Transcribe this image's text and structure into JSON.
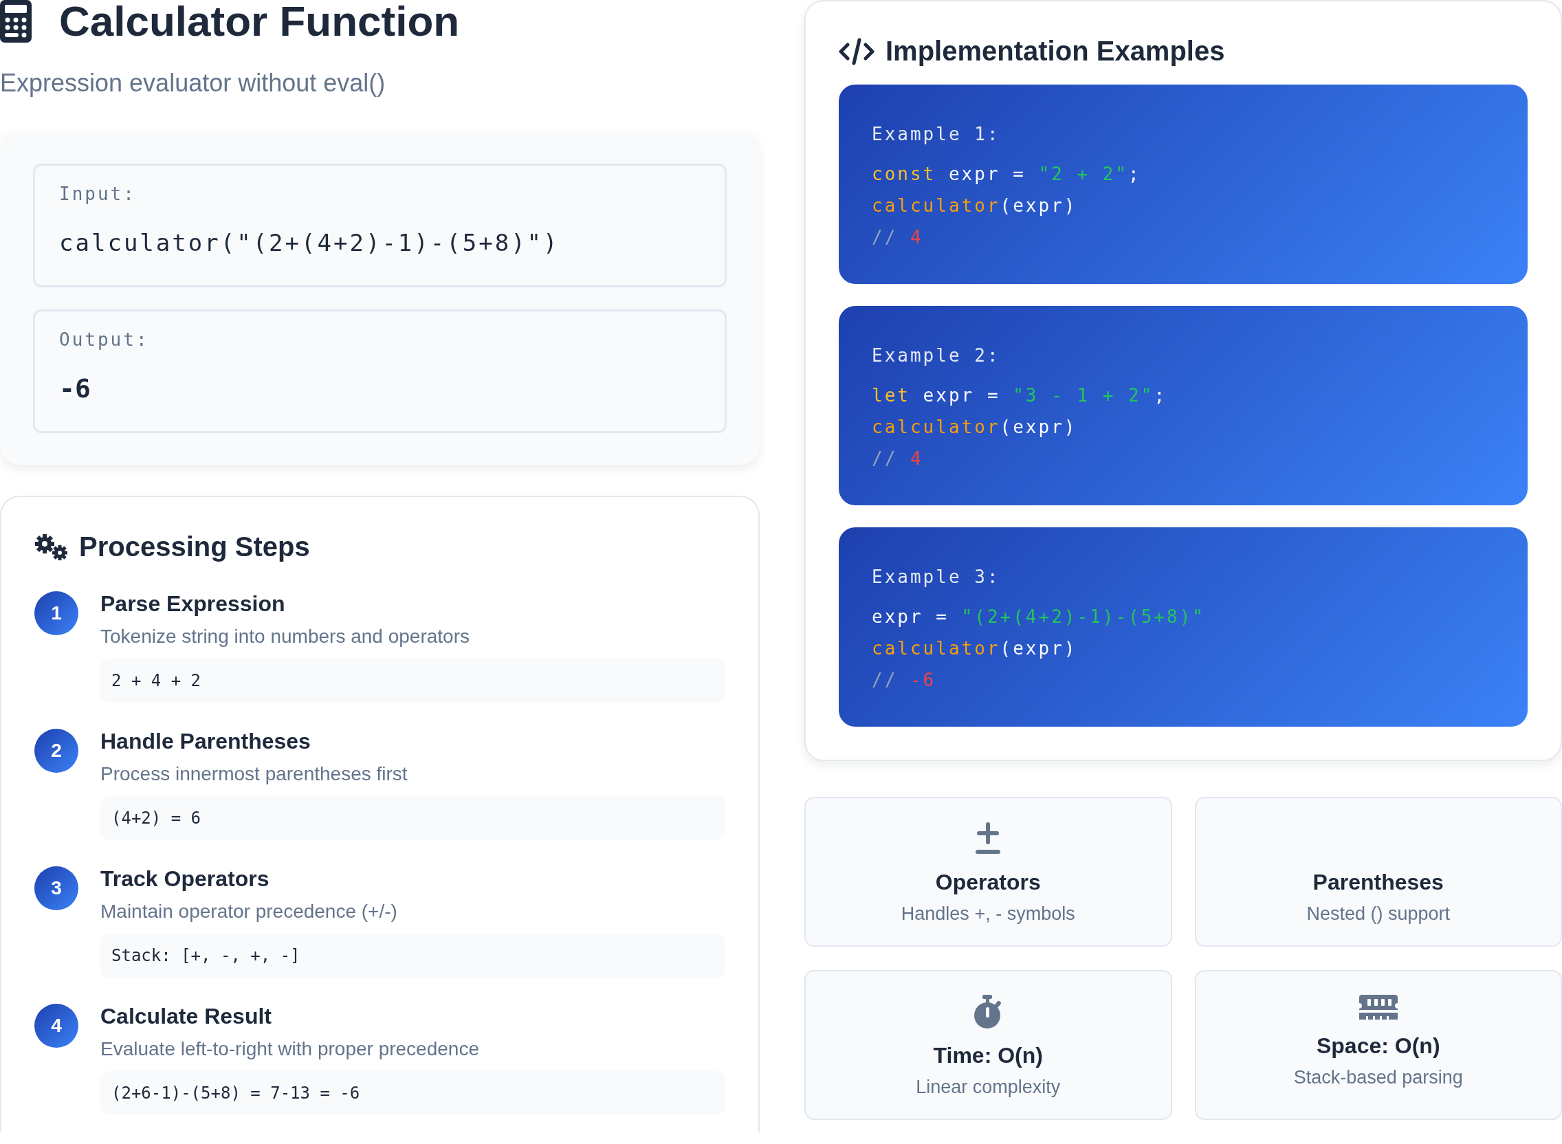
{
  "header": {
    "title": "Calculator Function",
    "subtitle": "Expression evaluator without eval()"
  },
  "io": [
    {
      "label": "Input:",
      "value": "calculator(\"(2+(4+2)-1)-(5+8)\")"
    },
    {
      "label": "Output:",
      "value": "-6"
    }
  ],
  "steps": {
    "title": "Processing Steps",
    "items": [
      {
        "number": "1",
        "title": "Parse Expression",
        "description": "Tokenize string into numbers and operators",
        "code": "2 + 4 + 2"
      },
      {
        "number": "2",
        "title": "Handle Parentheses",
        "description": "Process innermost parentheses first",
        "code": "(4+2) = 6"
      },
      {
        "number": "3",
        "title": "Track Operators",
        "description": "Maintain operator precedence (+/-)",
        "code": "Stack: [+, -, +, -]"
      },
      {
        "number": "4",
        "title": "Calculate Result",
        "description": "Evaluate left-to-right with proper precedence",
        "code": "(2+6-1)-(5+8) = 7-13 = -6"
      }
    ]
  },
  "examples": {
    "title": "Implementation Examples",
    "items": [
      {
        "label": "Example 1:",
        "lines": [
          [
            {
              "kind": "keyword",
              "text": "const"
            },
            {
              "kind": "plain",
              "text": " expr = "
            },
            {
              "kind": "string",
              "text": "\"2 + 2\""
            },
            {
              "kind": "plain",
              "text": ";"
            }
          ],
          [
            {
              "kind": "function",
              "text": "calculator"
            },
            {
              "kind": "plain",
              "text": "(expr)"
            }
          ],
          [
            {
              "kind": "comment",
              "text": "//"
            },
            {
              "kind": "result",
              "text": " 4"
            }
          ]
        ]
      },
      {
        "label": "Example 2:",
        "lines": [
          [
            {
              "kind": "keyword",
              "text": "let"
            },
            {
              "kind": "plain",
              "text": " expr = "
            },
            {
              "kind": "string",
              "text": "\"3 - 1 + 2\""
            },
            {
              "kind": "plain",
              "text": ";"
            }
          ],
          [
            {
              "kind": "function",
              "text": "calculator"
            },
            {
              "kind": "plain",
              "text": "(expr)"
            }
          ],
          [
            {
              "kind": "comment",
              "text": "//"
            },
            {
              "kind": "result",
              "text": " 4"
            }
          ]
        ]
      },
      {
        "label": "Example 3:",
        "lines": [
          [
            {
              "kind": "plain",
              "text": "expr = "
            },
            {
              "kind": "string",
              "text": "\"(2+(4+2)-1)-(5+8)\""
            }
          ],
          [
            {
              "kind": "function",
              "text": "calculator"
            },
            {
              "kind": "plain",
              "text": "(expr)"
            }
          ],
          [
            {
              "kind": "comment",
              "text": "//"
            },
            {
              "kind": "result",
              "text": " -6"
            }
          ]
        ]
      }
    ]
  },
  "features": [
    {
      "title": "Operators",
      "description": "Handles +, - symbols"
    },
    {
      "title": "Parentheses",
      "description": "Nested () support"
    },
    {
      "title": "Time: O(n)",
      "description": "Linear complexity"
    },
    {
      "title": "Space: O(n)",
      "description": "Stack-based parsing"
    }
  ]
}
